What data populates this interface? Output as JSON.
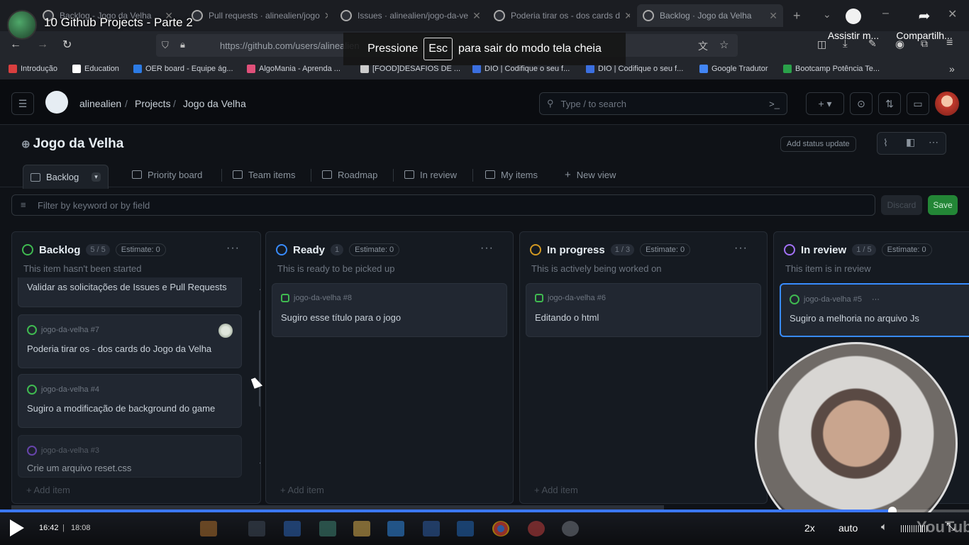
{
  "browser": {
    "tabs": [
      {
        "label": "Backlog - Jogo da Velha"
      },
      {
        "label": "Pull requests · alinealien/jogo"
      },
      {
        "label": "Issues · alinealien/jogo-da-ve"
      },
      {
        "label": "Poderia tirar os - dos cards d"
      },
      {
        "label": "Backlog · Jogo da Velha"
      }
    ],
    "url": "https://github.com/users/alinealien",
    "bookmarks": [
      {
        "label": "Introdução",
        "color": "#d93f3f"
      },
      {
        "label": "Education",
        "color": "#ffffff"
      },
      {
        "label": "OER board - Equipe ág...",
        "color": "#2c7be5"
      },
      {
        "label": "AlgoMania - Aprenda ...",
        "color": "#e0507a"
      },
      {
        "label": "[FOOD]DESAFIOS DE ...",
        "color": "#cccccc"
      },
      {
        "label": "DIO | Codifique o seu f...",
        "color": "#3b6fe0"
      },
      {
        "label": "DIO | Codifique o seu f...",
        "color": "#3b6fe0"
      },
      {
        "label": "Google Tradutor",
        "color": "#4285f4"
      },
      {
        "label": "Bootcamp Potência Te...",
        "color": "#2aa14a"
      }
    ]
  },
  "video": {
    "title": "10 Github Projects - Parte 2",
    "fullscreen_hint": {
      "prefix": "Pressione",
      "key": "Esc",
      "suffix": "para sair do modo tela cheia"
    },
    "watch_later": "Assistir m...",
    "share": "Compartilh...",
    "current_time": "16:42",
    "separator": "|",
    "duration": "18:08",
    "progress_fraction": 0.921,
    "speed": "2x",
    "quality": "auto",
    "watermark": "YouTube"
  },
  "github": {
    "breadcrumb": [
      "alinealien",
      "Projects",
      "Jogo da Velha"
    ],
    "search_placeholder": "Type / to search",
    "project_title": "Jogo da Velha",
    "add_status": "Add status update",
    "views": [
      "Backlog",
      "Priority board",
      "Team items",
      "Roadmap",
      "In review",
      "My items"
    ],
    "new_view": "New view",
    "filter_placeholder": "Filter by keyword or by field",
    "discard": "Discard",
    "save": "Save",
    "add_item": "Add item",
    "columns": [
      {
        "name": "Backlog",
        "count": "5 / 5",
        "estimate": "Estimate: 0",
        "desc": "This item hasn't been started",
        "color": "#3fb950",
        "cards": [
          {
            "ref": "",
            "title": "Validar as solicitações de Issues e Pull Requests"
          },
          {
            "ref": "jogo-da-velha #7",
            "title": "Poderia tirar os - dos cards do Jogo da Velha"
          },
          {
            "ref": "jogo-da-velha #4",
            "title": "Sugiro a modificação de background do game"
          },
          {
            "ref": "jogo-da-velha #3",
            "title": "Crie um arquivo reset.css"
          }
        ]
      },
      {
        "name": "Ready",
        "count": "1",
        "estimate": "Estimate: 0",
        "desc": "This is ready to be picked up",
        "color": "#388bfd",
        "cards": [
          {
            "ref": "jogo-da-velha #8",
            "title": "Sugiro esse título para o jogo"
          }
        ]
      },
      {
        "name": "In progress",
        "count": "1 / 3",
        "estimate": "Estimate: 0",
        "desc": "This is actively being worked on",
        "color": "#d29922",
        "cards": [
          {
            "ref": "jogo-da-velha #6",
            "title": "Editando o html"
          }
        ]
      },
      {
        "name": "In review",
        "count": "1 / 5",
        "estimate": "Estimate: 0",
        "desc": "This item is in review",
        "color": "#a371f7",
        "cards": [
          {
            "ref": "jogo-da-velha #5",
            "title": "Sugiro a melhoria no arquivo Js"
          }
        ]
      }
    ]
  }
}
